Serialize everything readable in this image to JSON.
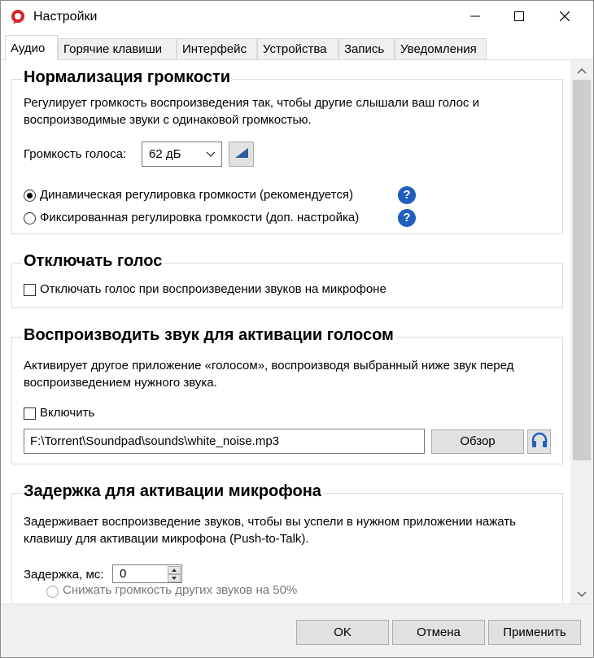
{
  "window": {
    "title": "Настройки",
    "icon": "soundpad-logo-icon"
  },
  "tabs": [
    {
      "label": "Аудио",
      "active": true
    },
    {
      "label": "Горячие клавиши",
      "active": false
    },
    {
      "label": "Интерфейс",
      "active": false
    },
    {
      "label": "Устройства",
      "active": false
    },
    {
      "label": "Запись",
      "active": false
    },
    {
      "label": "Уведомления",
      "active": false
    }
  ],
  "normalization": {
    "title": "Нормализация громкости",
    "description": "Регулирует громкость воспроизведения так, чтобы другие слышали ваш голос и воспроизводимые звуки с одинаковой громкостью.",
    "voice_volume_label": "Громкость голоса:",
    "voice_volume_value": "62 дБ",
    "options": [
      {
        "label": "Динамическая регулировка громкости (рекомендуется)",
        "selected": true
      },
      {
        "label": "Фиксированная регулировка громкости (доп. настройка)",
        "selected": false
      }
    ]
  },
  "mute_voice": {
    "title": "Отключать голос",
    "checkbox_label": "Отключать голос при воспроизведении звуков на микрофоне",
    "checked": false
  },
  "voice_activation": {
    "title": "Воспроизводить звук для активации голосом",
    "description": "Активирует другое приложение «голосом», воспроизводя выбранный ниже звук перед воспроизведением нужного звука.",
    "enable_label": "Включить",
    "enabled": false,
    "file_path": "F:\\Torrent\\Soundpad\\sounds\\white_noise.mp3",
    "browse_label": "Обзор"
  },
  "mic_delay": {
    "title": "Задержка для активации микрофона",
    "description": "Задерживает воспроизведение звуков, чтобы вы успели в нужном приложении нажать клавишу для активации микрофона (Push-to-Talk).",
    "delay_label": "Задержка, мс:",
    "delay_value": "0",
    "partial_option_label": "Снижать громкость других звуков на 50%"
  },
  "footer": {
    "ok_label": "OK",
    "cancel_label": "Отмена",
    "apply_label": "Применить"
  },
  "colors": {
    "accent": "#1e5fbf",
    "logo_red": "#d9232a"
  }
}
